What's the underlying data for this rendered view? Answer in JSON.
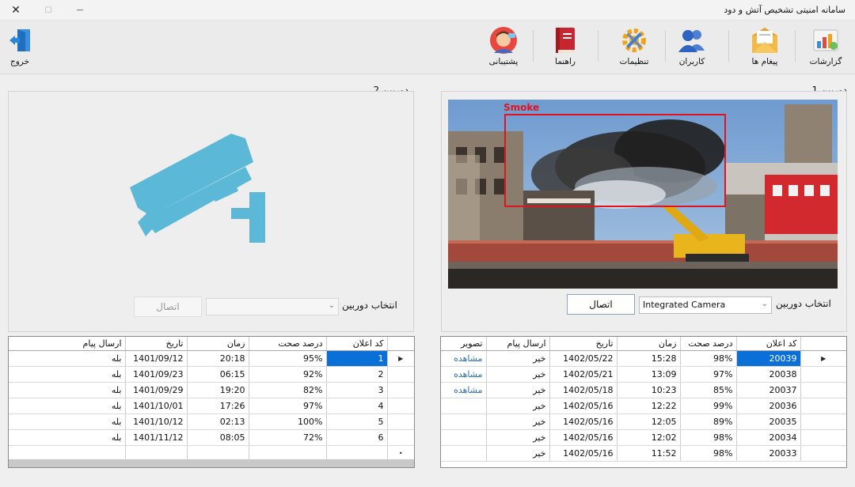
{
  "window": {
    "title": "سامانه امنیتی تشخیص آتش و دود",
    "close_glyph": "✕",
    "maximize_glyph": "☐",
    "minimize_glyph": "—"
  },
  "toolbar": {
    "reports": "گزارشات",
    "messages": "پیغام ها",
    "users": "کاربران",
    "settings": "تنظیمات",
    "help": "راهنما",
    "support": "پشتیبانی",
    "exit": "خروج"
  },
  "camera1": {
    "title": "دوربین 1",
    "detection_label": "Smoke",
    "select_label": "انتخاب دوربین",
    "selected_camera": "Integrated Camera",
    "connect": "اتصال",
    "columns": [
      "کد اعلان",
      "درصد صحت",
      "زمان",
      "تاریخ",
      "ارسال پیام",
      "تصویر"
    ],
    "rows": [
      [
        "20039",
        "98%",
        "15:28",
        "1402/05/22",
        "خیر",
        "مشاهده"
      ],
      [
        "20038",
        "97%",
        "13:09",
        "1402/05/21",
        "خیر",
        "مشاهده"
      ],
      [
        "20037",
        "85%",
        "10:23",
        "1402/05/18",
        "خیر",
        "مشاهده"
      ],
      [
        "20036",
        "99%",
        "12:22",
        "1402/05/16",
        "خیر",
        ""
      ],
      [
        "20035",
        "89%",
        "12:05",
        "1402/05/16",
        "خیر",
        ""
      ],
      [
        "20034",
        "98%",
        "12:02",
        "1402/05/16",
        "خیر",
        ""
      ],
      [
        "20033",
        "98%",
        "11:52",
        "1402/05/16",
        "خیر",
        ""
      ]
    ]
  },
  "camera2": {
    "title": "دوربین 2",
    "select_label": "انتخاب دوربین",
    "selected_camera": "",
    "connect": "اتصال",
    "columns": [
      "کد اعلان",
      "درصد صحت",
      "زمان",
      "تاریخ",
      "ارسال پیام"
    ],
    "rows": [
      [
        "1",
        "95%",
        "20:18",
        "1401/09/12",
        "بله"
      ],
      [
        "2",
        "92%",
        "06:15",
        "1401/09/23",
        "بله"
      ],
      [
        "3",
        "82%",
        "19:20",
        "1401/09/29",
        "بله"
      ],
      [
        "4",
        "97%",
        "17:26",
        "1401/10/01",
        "بله"
      ],
      [
        "5",
        "100%",
        "02:13",
        "1401/10/12",
        "بله"
      ],
      [
        "6",
        "72%",
        "08:05",
        "1401/11/12",
        "بله"
      ]
    ]
  },
  "colors": {
    "accent_selection": "#0a6fd6",
    "detection_box": "#e0141e",
    "camera_icon": "#5bb8d6",
    "link": "#2a6fb8"
  }
}
